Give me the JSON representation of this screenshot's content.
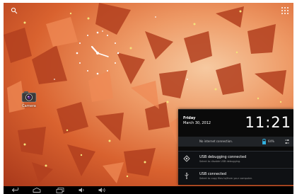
{
  "desktop": {
    "apps": [
      {
        "label": "Camera",
        "icon": "camera-icon"
      }
    ]
  },
  "notification_panel": {
    "day": "Friday",
    "date": "March 30, 2012",
    "time": "11:21",
    "connection": "No internet connection.",
    "battery": "64%",
    "battery_level": 0.64,
    "notifications": [
      {
        "title": "USB debugging connected",
        "subtitle": "Select to disable USB debugging.",
        "icon": "debug-icon"
      },
      {
        "title": "USB connected",
        "subtitle": "Select to copy files to/from your computer.",
        "icon": "usb-icon"
      }
    ]
  },
  "colors": {
    "wallpaper": "#d9622f",
    "panel": "#0a0a0a",
    "navbar": "#000000"
  }
}
